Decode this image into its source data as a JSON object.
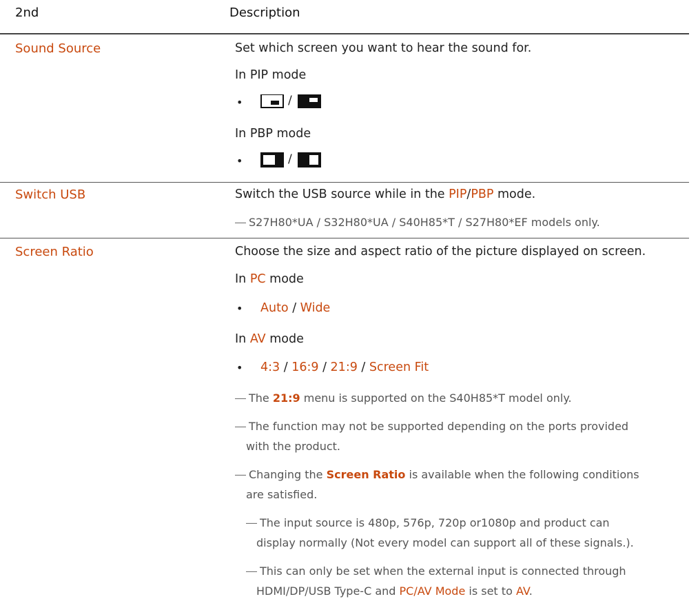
{
  "header": {
    "col1": "2nd",
    "col2": "Description"
  },
  "rows": {
    "sound_source": {
      "name": "Sound Source",
      "desc": "Set which screen you want to hear the sound for.",
      "pip_label": "In PIP mode",
      "pbp_label": "In PBP mode",
      "slash": "/"
    },
    "switch_usb": {
      "name": "Switch USB",
      "desc_prefix": "Switch the USB source while in the ",
      "pip": "PIP",
      "sep": "/",
      "pbp": "PBP",
      "desc_suffix": " mode.",
      "note": "S27H80*UA / S32H80*UA / S40H85*T / S27H80*EF models only."
    },
    "screen_ratio": {
      "name": "Screen Ratio",
      "desc": "Choose the size and aspect ratio of the picture displayed on screen.",
      "pc_prefix": "In ",
      "pc": "PC",
      "pc_suffix": " mode",
      "pc_options": [
        "Auto",
        "Wide"
      ],
      "av_prefix": "In ",
      "av": "AV",
      "av_suffix": " mode",
      "av_options": [
        "4:3",
        "16:9",
        "21:9",
        "Screen Fit"
      ],
      "option_sep": " / ",
      "note1_prefix": "The ",
      "note1_hl": "21:9",
      "note1_suffix": " menu is supported on the S40H85*T model only.",
      "note2_line1": "The function may not be supported depending on the ports provided",
      "note2_line2": "with the product.",
      "note3_prefix": "Changing the ",
      "note3_hl": "Screen Ratio",
      "note3_suffix": " is available when the following conditions",
      "note3_line2": "are satisfied.",
      "sub1_line1": "The input source is 480p, 576p, 720p or1080p and product can",
      "sub1_line2": "display normally (Not every model can support all of these signals.).",
      "sub2_line1": "This can only be set when the external input is connected through",
      "sub2_prefix": "HDMI/DP/USB Type-C and ",
      "sub2_hl1": "PC/AV Mode",
      "sub2_mid": " is set to ",
      "sub2_hl2": "AV",
      "sub2_end": "."
    }
  },
  "bullet_char": "•",
  "note_dash": "―",
  "colors": {
    "accent": "#c8490e",
    "text": "#222222",
    "note": "#555555"
  }
}
